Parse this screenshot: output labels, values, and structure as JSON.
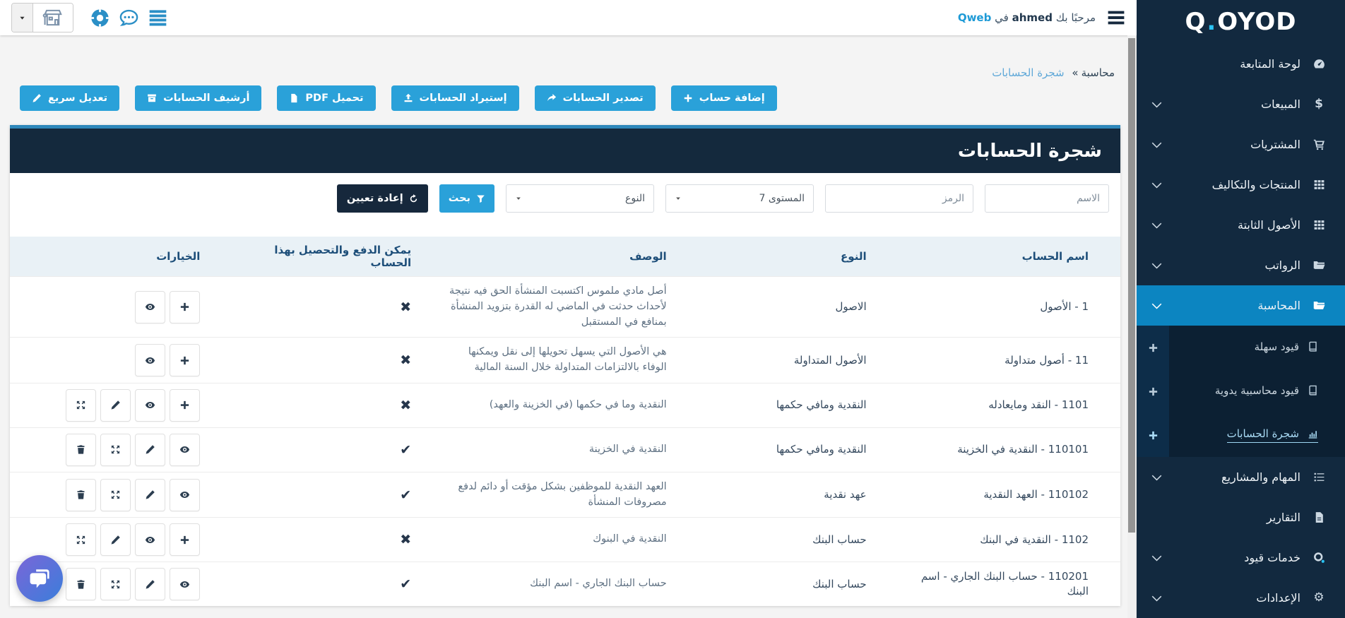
{
  "colors": {
    "accent": "#2aa1d9",
    "sidebar_bg": "#12293f",
    "sidebar_active": "#0c85c1",
    "submenu_bg": "#0c2033",
    "plus_strip": "#0d2d49",
    "panel_head": "#14293d",
    "panel_head_border": "#2e87ba",
    "dark_button": "#16283c",
    "table_header_bg": "#e9f1f6",
    "table_header_text": "#1d4e79",
    "link_blue": "#5fa8d8",
    "qweb_blue": "#1e9ad6",
    "logo_dot": "#2bc3f3"
  },
  "header": {
    "welcome_prefix": "مرحبًا بك",
    "welcome_user": "ahmed",
    "welcome_middle": "في",
    "welcome_org": "Qweb",
    "quick_icons": [
      "list",
      "chat",
      "ring"
    ]
  },
  "sidebar": {
    "logo_q": "Q",
    "logo_dot": ".",
    "logo_rest": "OYOD",
    "items": [
      {
        "label": "لوحة المتابعة",
        "icon": "gauge",
        "chevron": false
      },
      {
        "label": "المبيعات",
        "icon": "dollar",
        "chevron": true
      },
      {
        "label": "المشتريات",
        "icon": "cart",
        "chevron": true
      },
      {
        "label": "المنتجات والتكاليف",
        "icon": "grid",
        "chevron": true
      },
      {
        "label": "الأصول الثابتة",
        "icon": "grid",
        "chevron": true
      },
      {
        "label": "الرواتب",
        "icon": "folder",
        "chevron": true
      },
      {
        "label": "المحاسبة",
        "icon": "folder",
        "chevron": true,
        "active": true,
        "submenu": [
          {
            "label": "قيود سهلة",
            "icon": "book",
            "plus": true
          },
          {
            "label": "قيود محاسبية يدوية",
            "icon": "book",
            "plus": true
          },
          {
            "label": "شجرة الحسابات",
            "icon": "chart",
            "plus": true,
            "active": true
          }
        ]
      },
      {
        "label": "المهام والمشاريع",
        "icon": "tasks",
        "chevron": true
      },
      {
        "label": "التقارير",
        "icon": "report",
        "chevron": false
      },
      {
        "label": "خدمات قيود",
        "icon": "qoyod",
        "chevron": true
      },
      {
        "label": "الإعدادات",
        "icon": "gear",
        "chevron": true
      }
    ]
  },
  "breadcrumb": {
    "parent": "محاسبة",
    "separator": "»",
    "current": "شجرة الحسابات"
  },
  "toolbar": {
    "buttons": [
      {
        "label": "إضافة حساب",
        "icon": "plus"
      },
      {
        "label": "تصدير الحسابات",
        "icon": "export"
      },
      {
        "label": "إستيراد الحسابات",
        "icon": "import"
      },
      {
        "label": "تحميل PDF",
        "icon": "file"
      },
      {
        "label": "أرشيف الحسابات",
        "icon": "archive"
      },
      {
        "label": "تعديل سريع",
        "icon": "pencil"
      }
    ]
  },
  "panel": {
    "title": "شجرة الحسابات"
  },
  "filters": {
    "name_placeholder": "الاسم",
    "code_placeholder": "الرمز",
    "level_value": "المستوى 7",
    "type_value": "النوع",
    "search_label": "بحث",
    "reset_label": "إعادة تعيين"
  },
  "table": {
    "columns": [
      "اسم الحساب",
      "النوع",
      "الوصف",
      "يمكن الدفع والتحصيل بهذا الحساب",
      "الخيارات"
    ],
    "marks": {
      "yes": "✔",
      "no": "✖"
    },
    "rows": [
      {
        "name": "1 - الأصول",
        "type": "الاصول",
        "desc": "أصل مادي ملموس اكتسبت المنشأة الحق فيه نتيجة لأحداث حدثت في الماضي له القدرة بتزويد المنشأة بمنافع في المستقبل",
        "payable": false,
        "actions": [
          "plus",
          "eye"
        ]
      },
      {
        "name": "11 - أصول متداولة",
        "type": "الأصول المتداولة",
        "desc": "هي الأصول التي يسهل تحويلها إلى نقل ويمكنها الوفاء بالالتزامات المتداولة خلال السنة المالية",
        "payable": false,
        "actions": [
          "plus",
          "eye"
        ]
      },
      {
        "name": "1101 - النقد ومايعادله",
        "type": "النقدية ومافي حكمها",
        "desc": "النقدية وما في حكمها (في الخزينة والعهد)",
        "payable": false,
        "actions": [
          "plus",
          "eye",
          "pencil",
          "move"
        ]
      },
      {
        "name": "110101 - النقدية في الخزينة",
        "type": "النقدية ومافي حكمها",
        "desc": "النقدية في الخزينة",
        "payable": true,
        "actions": [
          "eye",
          "pencil",
          "move",
          "trash"
        ]
      },
      {
        "name": "110102 - العهد النقدية",
        "type": "عهد نقدية",
        "desc": "العهد النقدية للموظفين بشكل مؤقت أو دائم لدفع مصروفات المنشأة",
        "payable": true,
        "actions": [
          "eye",
          "pencil",
          "move",
          "trash"
        ]
      },
      {
        "name": "1102 - النقدية في البنك",
        "type": "حساب البنك",
        "desc": "النقدية في البنوك",
        "payable": false,
        "actions": [
          "plus",
          "eye",
          "pencil",
          "move"
        ]
      },
      {
        "name": "110201 - حساب البنك الجاري - اسم البنك",
        "type": "حساب البنك",
        "desc": "حساب البنك الجاري - اسم البنك",
        "payable": true,
        "actions": [
          "eye",
          "pencil",
          "move",
          "trash"
        ]
      }
    ]
  }
}
